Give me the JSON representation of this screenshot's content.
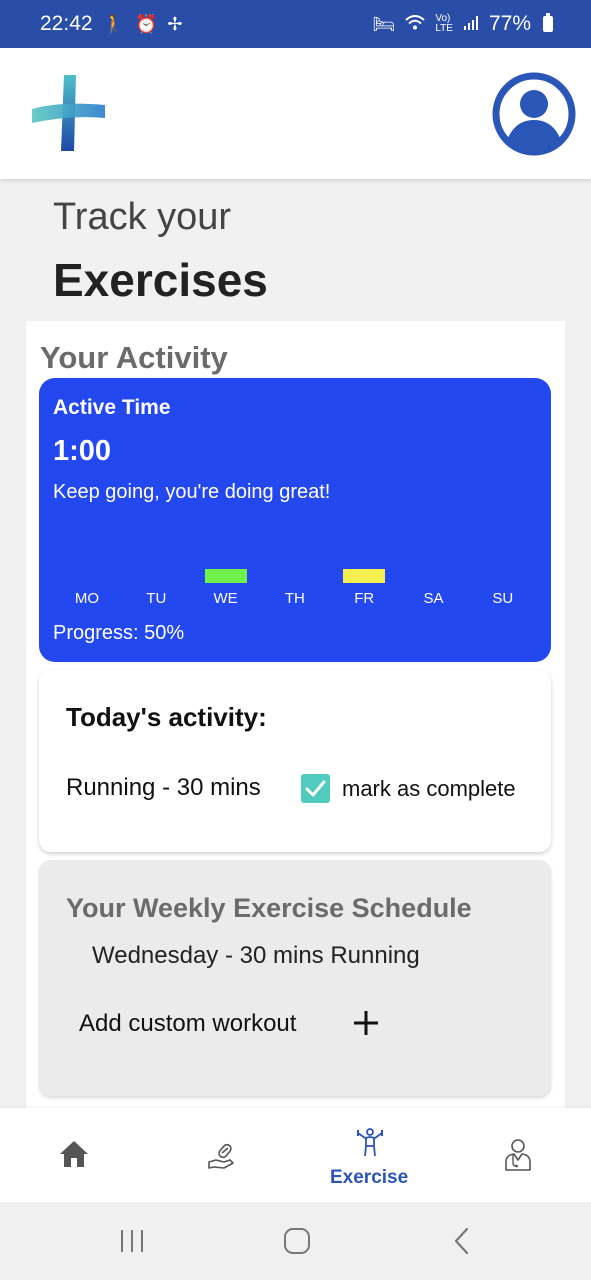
{
  "status_bar": {
    "time": "22:42",
    "battery": "77%",
    "left_icons": [
      "walking-icon",
      "alarm-icon",
      "fan-icon"
    ],
    "right_icons": [
      "bed-icon",
      "wifi-icon",
      "volte-icon",
      "signal-icon",
      "battery-icon"
    ]
  },
  "header": {
    "title_line1": "Track your",
    "title_line2": "Exercises"
  },
  "activity": {
    "section_title": "Your Activity",
    "active_label": "Active Time",
    "active_value": "1:00",
    "message": "Keep going, you're doing great!",
    "progress_text": "Progress: 50%",
    "days": [
      {
        "label": "MO",
        "bar_color": null
      },
      {
        "label": "TU",
        "bar_color": null
      },
      {
        "label": "WE",
        "bar_color": "#6ef24a"
      },
      {
        "label": "TH",
        "bar_color": null
      },
      {
        "label": "FR",
        "bar_color": "#f5f050"
      },
      {
        "label": "SA",
        "bar_color": null
      },
      {
        "label": "SU",
        "bar_color": null
      }
    ]
  },
  "today": {
    "title": "Today's activity:",
    "item": "Running - 30 mins",
    "complete_label": "mark as complete",
    "checked": true
  },
  "schedule": {
    "title": "Your Weekly Exercise Schedule",
    "item": "Wednesday - 30 mins Running",
    "add_label": "Add custom workout"
  },
  "bottom_nav": {
    "items": [
      {
        "icon": "home-icon",
        "label": ""
      },
      {
        "icon": "medicine-hand-icon",
        "label": ""
      },
      {
        "icon": "exercise-icon",
        "label": "Exercise"
      },
      {
        "icon": "doctor-icon",
        "label": ""
      }
    ],
    "active_index": 2
  },
  "colors": {
    "status_bar": "#2a4ea8",
    "active_card": "#2448f0",
    "accent": "#2a56b8",
    "checkbox": "#52cbbf"
  }
}
